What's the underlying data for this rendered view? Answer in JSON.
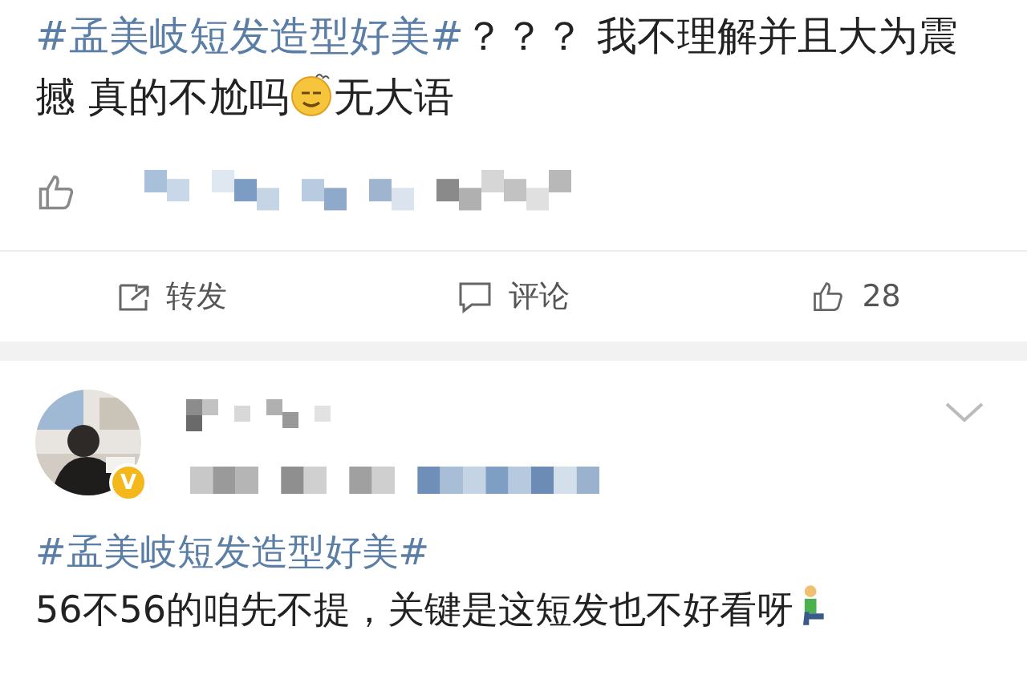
{
  "post": {
    "segments": [
      {
        "kind": "hashtag",
        "text": "#孟美岐短发造型好美#"
      },
      {
        "kind": "text",
        "text": "？？？ 我不理解并且大为震撼 真的不尬吗"
      },
      {
        "kind": "emoji"
      },
      {
        "kind": "text",
        "text": "无大语"
      }
    ],
    "actions": [
      {
        "kind": "repost",
        "label": "转发"
      },
      {
        "kind": "comment",
        "label": "评论"
      },
      {
        "kind": "like",
        "label": "28"
      }
    ]
  },
  "reply": {
    "badge": "V",
    "segments": [
      {
        "kind": "hashtag",
        "text": "#孟美岐短发造型好美#"
      },
      {
        "kind": "break"
      },
      {
        "kind": "text",
        "text": "56不56的咱先不提，关键是这短发也不好看呀"
      },
      {
        "kind": "figure"
      }
    ]
  }
}
